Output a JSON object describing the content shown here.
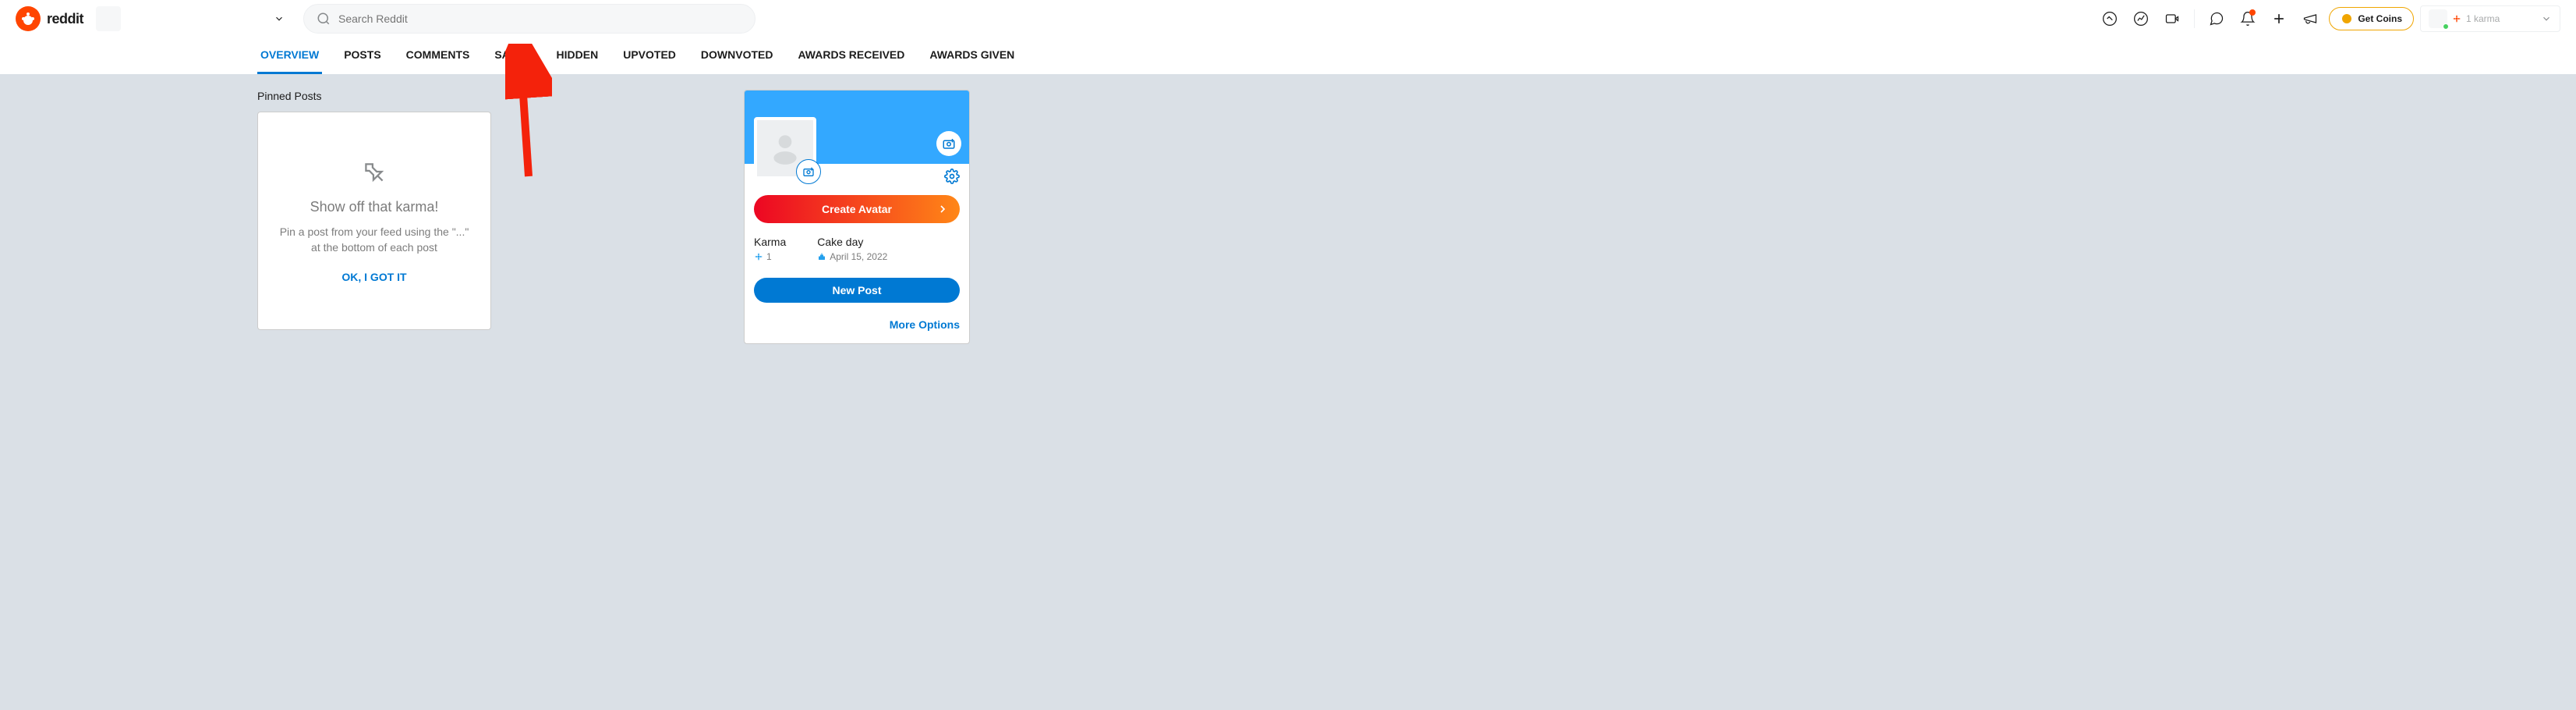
{
  "brand": "reddit",
  "search": {
    "placeholder": "Search Reddit"
  },
  "coins_label": "Get Coins",
  "user_karma": "1 karma",
  "tabs": [
    {
      "label": "OVERVIEW",
      "active": true
    },
    {
      "label": "POSTS"
    },
    {
      "label": "COMMENTS"
    },
    {
      "label": "SAVED"
    },
    {
      "label": "HIDDEN"
    },
    {
      "label": "UPVOTED"
    },
    {
      "label": "DOWNVOTED"
    },
    {
      "label": "AWARDS RECEIVED"
    },
    {
      "label": "AWARDS GIVEN"
    }
  ],
  "pinned": {
    "section_title": "Pinned Posts",
    "title": "Show off that karma!",
    "desc": "Pin a post from your feed using the \"...\" at the bottom of each post",
    "ok": "OK, I GOT IT"
  },
  "profile": {
    "create_avatar": "Create Avatar",
    "karma_label": "Karma",
    "karma_value": "1",
    "cake_label": "Cake day",
    "cake_value": "April 15, 2022",
    "new_post": "New Post",
    "more_options": "More Options"
  },
  "colors": {
    "accent": "#0079d3",
    "orange": "#ff4500",
    "banner": "#33a8ff"
  }
}
